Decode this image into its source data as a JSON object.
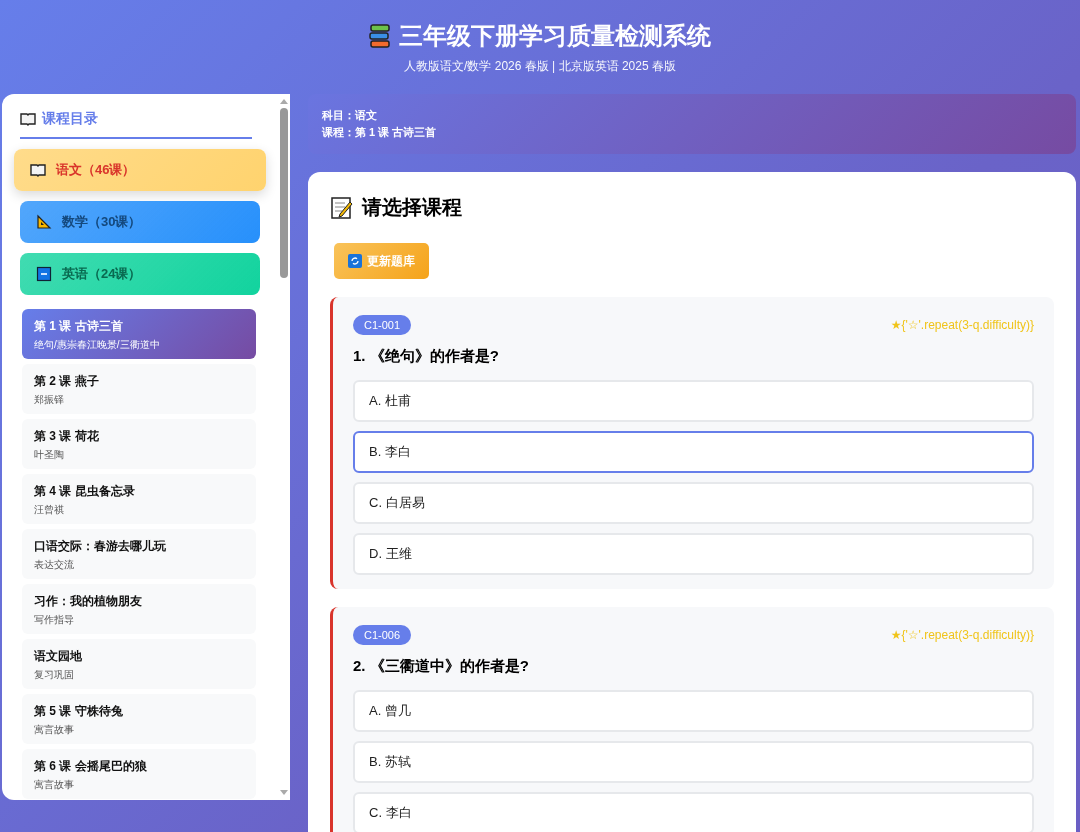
{
  "header": {
    "title": "三年级下册学习质量检测系统",
    "subtitle": "人教版语文/数学 2026 春版 | 北京版英语 2025 春版"
  },
  "sidebar": {
    "title": "课程目录",
    "subjects": [
      {
        "kind": "chinese",
        "label": "语文（46课）",
        "selected": true,
        "color": "#ffd36e"
      },
      {
        "kind": "math",
        "label": "数学（30课）",
        "selected": false,
        "color": "#2f8ff0"
      },
      {
        "kind": "english",
        "label": "英语（24课）",
        "selected": false,
        "color": "#1fcf9f"
      }
    ],
    "lessons": [
      {
        "title": "第 1 课 古诗三首",
        "subtitle": "绝句/惠崇春江晚景/三衢道中",
        "selected": true
      },
      {
        "title": "第 2 课 燕子",
        "subtitle": "郑振铎",
        "selected": false
      },
      {
        "title": "第 3 课 荷花",
        "subtitle": "叶圣陶",
        "selected": false
      },
      {
        "title": "第 4 课 昆虫备忘录",
        "subtitle": "汪曾祺",
        "selected": false
      },
      {
        "title": "口语交际：春游去哪儿玩",
        "subtitle": "表达交流",
        "selected": false
      },
      {
        "title": "习作：我的植物朋友",
        "subtitle": "写作指导",
        "selected": false
      },
      {
        "title": "语文园地",
        "subtitle": "复习巩固",
        "selected": false
      },
      {
        "title": "第 5 课 守株待兔",
        "subtitle": "寓言故事",
        "selected": false
      },
      {
        "title": "第 6 课 会摇尾巴的狼",
        "subtitle": "寓言故事",
        "selected": false
      }
    ]
  },
  "info": {
    "subject_label": "科目：",
    "subject": "语文",
    "lesson_label": "课程：",
    "lesson": "第 1 课 古诗三首"
  },
  "main": {
    "heading": "请选择课程",
    "update_button": "更新题库",
    "questions": [
      {
        "code": "C1-001",
        "difficulty": "★{'☆'.repeat(3-q.difficulty)}",
        "text": "1. 《绝句》的作者是?",
        "options": [
          {
            "text": "A. 杜甫",
            "selected": false
          },
          {
            "text": "B. 李白",
            "selected": true
          },
          {
            "text": "C. 白居易",
            "selected": false
          },
          {
            "text": "D. 王维",
            "selected": false
          }
        ]
      },
      {
        "code": "C1-006",
        "difficulty": "★{'☆'.repeat(3-q.difficulty)}",
        "text": "2. 《三衢道中》的作者是?",
        "options": [
          {
            "text": "A. 曾几",
            "selected": false
          },
          {
            "text": "B. 苏轼",
            "selected": false
          },
          {
            "text": "C. 李白",
            "selected": false
          }
        ]
      }
    ]
  }
}
